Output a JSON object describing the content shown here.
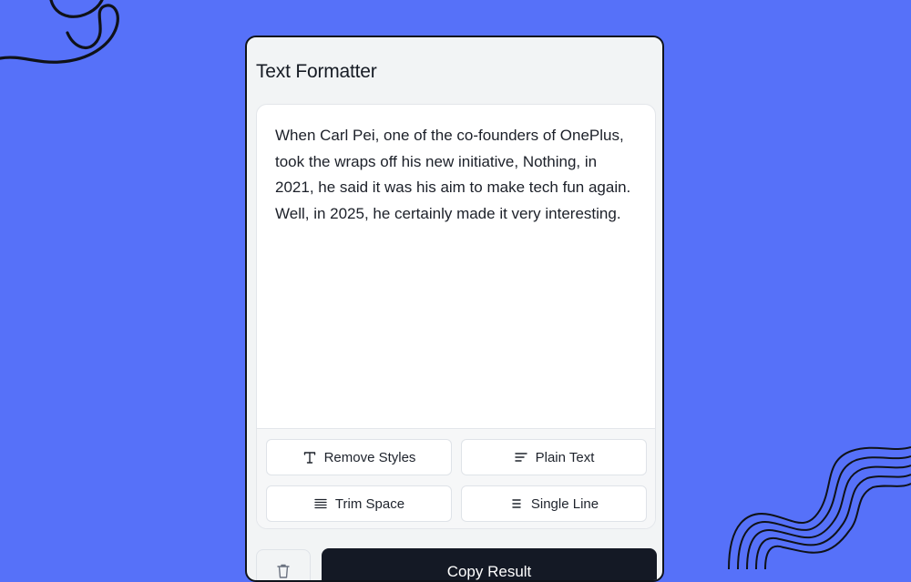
{
  "app": {
    "title": "Text Formatter"
  },
  "editor": {
    "text": "When Carl Pei, one of the co-founders of OnePlus, took the wraps off his new initiative, Nothing, in 2021, he said it was his aim to make tech fun again. Well, in 2025, he certainly made it very interesting."
  },
  "toolbar": {
    "buttons": [
      {
        "label": "Remove Styles",
        "icon": "text-type-icon"
      },
      {
        "label": "Plain Text",
        "icon": "align-left-lines-icon"
      },
      {
        "label": "Trim Space",
        "icon": "justify-lines-icon"
      },
      {
        "label": "Single Line",
        "icon": "center-lines-icon"
      }
    ]
  },
  "actions": {
    "trash_icon": "trash-icon",
    "copy_label": "Copy Result"
  },
  "colors": {
    "background": "#5671f9",
    "window": "#f2f4f5",
    "primary_button": "#141925"
  }
}
